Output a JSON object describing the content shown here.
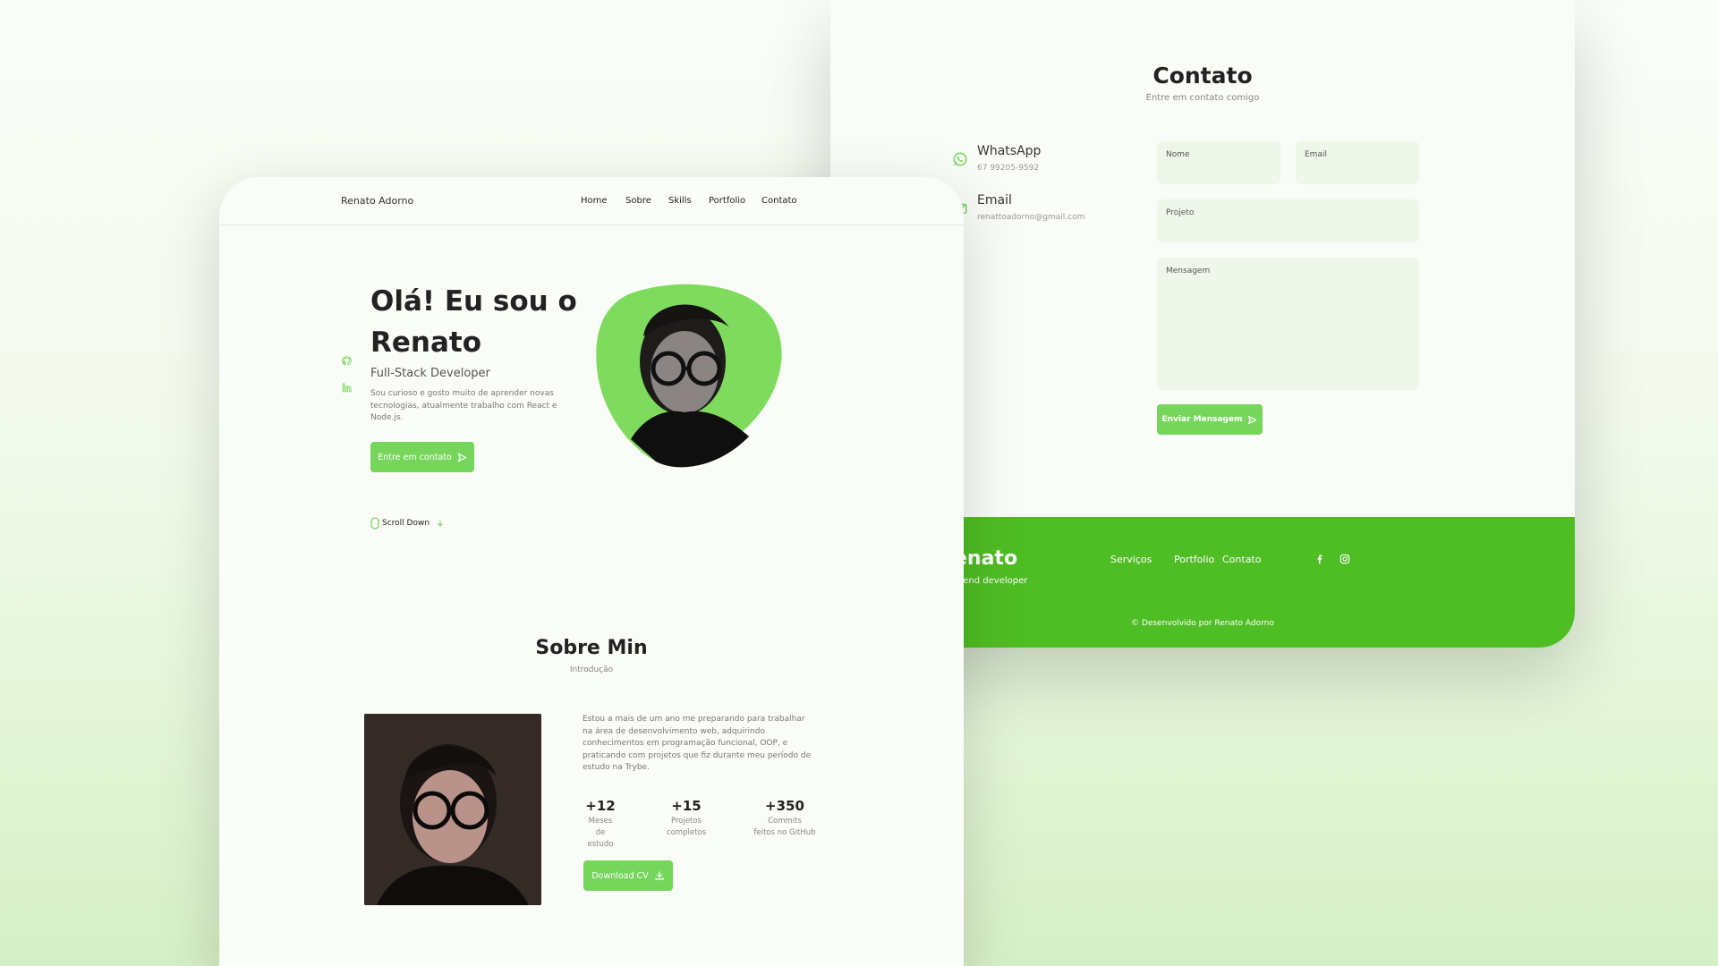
{
  "contact": {
    "title": "Contato",
    "subtitle": "Entre em contato comigo",
    "whatsapp": {
      "title": "WhatsApp",
      "value": "67 99205-9592",
      "icon": "whatsapp-icon"
    },
    "email": {
      "title": "Email",
      "value": "renattoadorno@gmail.com",
      "icon": "email-icon"
    },
    "form": {
      "name_label": "Nome",
      "email_label": "Email",
      "project_label": "Projeto",
      "message_label": "Mensagem",
      "submit_label": "Enviar Mensagem"
    }
  },
  "footer": {
    "brand": "enato",
    "tagline": "ntend developer",
    "links": [
      "Serviços",
      "Portfolio",
      "Contato"
    ],
    "social_icons": [
      "facebook-icon",
      "instagram-icon"
    ],
    "copyright": "© Desenvolvido por Renato Adorno"
  },
  "header": {
    "logo": "Renato Adorno",
    "nav": [
      "Home",
      "Sobre",
      "Skills",
      "Portfolio",
      "Contato"
    ]
  },
  "hero": {
    "title": "Olá! Eu sou o Renato",
    "subtitle": "Full-Stack Developer",
    "description": "Sou curioso e gosto muito de aprender novas tecnologias, atualmente trabalho com React e Node.js.",
    "cta_label": "Entre em contato",
    "scroll_label": "Scroll Down",
    "side_icons": [
      "github-icon",
      "linkedin-icon"
    ]
  },
  "about": {
    "title": "Sobre Min",
    "subtitle": "Introdução",
    "text": "Estou a mais de um ano me preparando para trabalhar na área de desenvolvimento web, adquirindo conhecimentos em programação funcional, OOP, e praticando com projetos que fiz durante meu período de estudo na Trybe.",
    "stats": [
      {
        "value": "+12",
        "line1": "Meses",
        "line2": "de estudo"
      },
      {
        "value": "+15",
        "line1": "Projetos",
        "line2": "completos"
      },
      {
        "value": "+350",
        "line1": "Commits",
        "line2": "feitos no GitHub"
      }
    ],
    "cv_label": "Download CV"
  },
  "colors": {
    "accent": "#76d65b",
    "footer": "#4fbd24",
    "background": "#fafcf8"
  }
}
